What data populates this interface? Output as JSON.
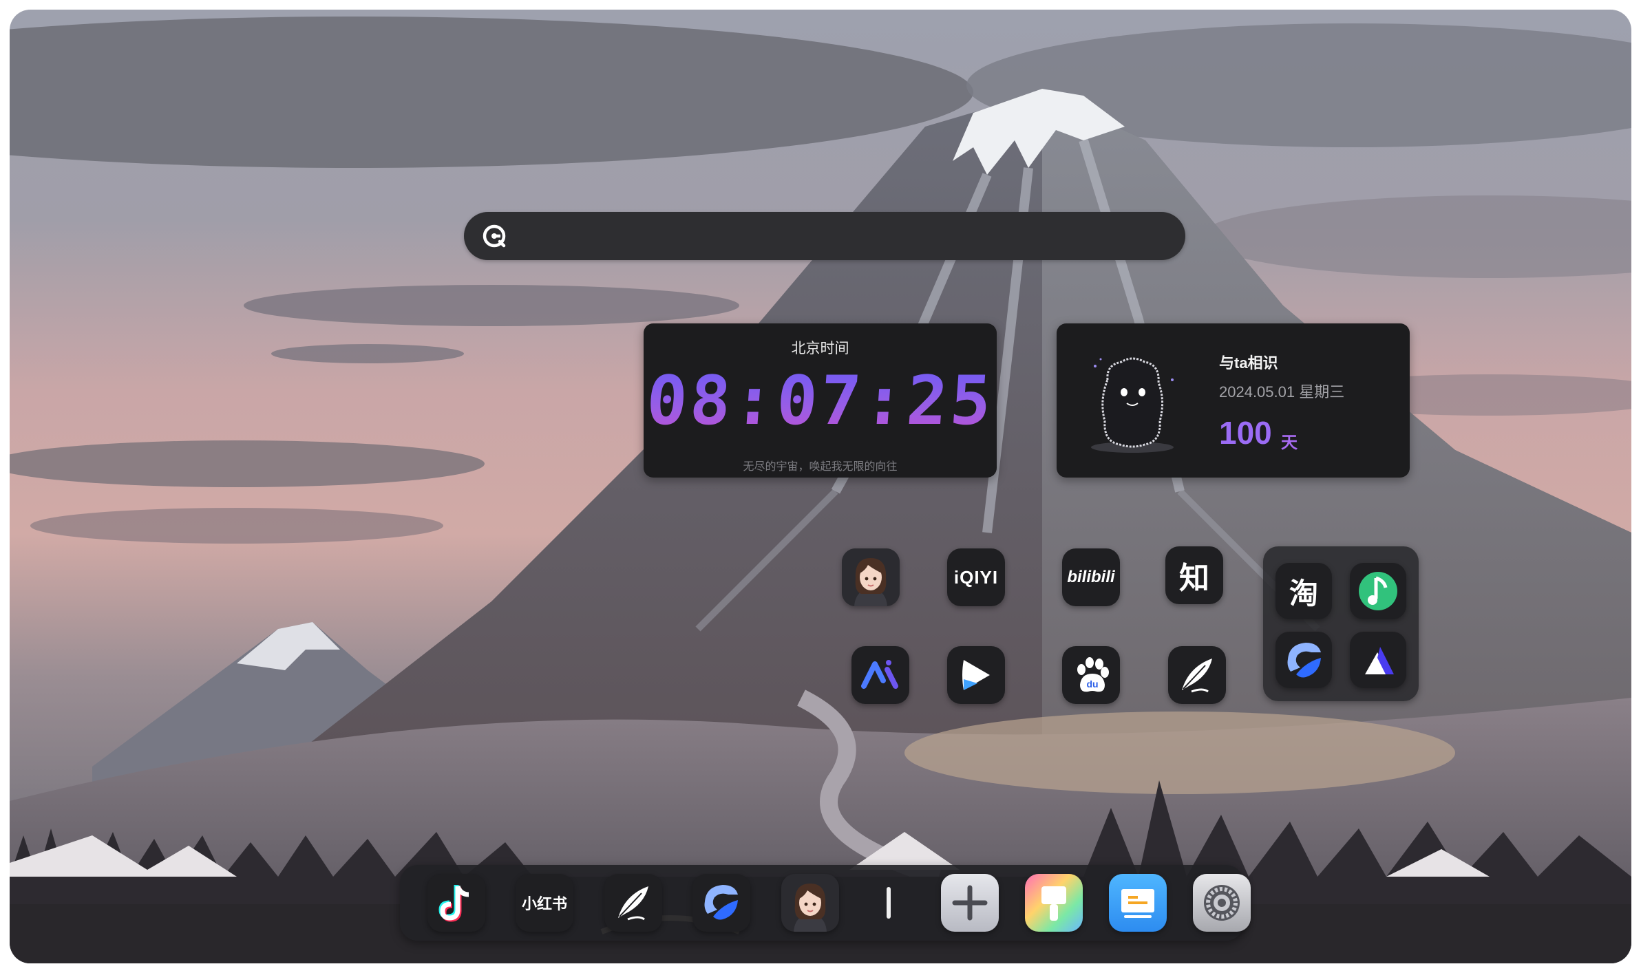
{
  "search": {
    "placeholder": "",
    "icon": "search-logo-icon"
  },
  "clock_widget": {
    "title": "北京时间",
    "time": "08:07:25",
    "subtitle": "无尽的宇宙，唤起我无限的向往"
  },
  "anniversary_widget": {
    "title": "与ta相识",
    "date": "2024.05.01  星期三",
    "count": "100",
    "unit": "天"
  },
  "apps": {
    "iqiyi": "iQIYI",
    "bilibili": "bilibili",
    "zhihu": "知",
    "taobao": "淘",
    "xiaohongshu": "小红书"
  },
  "folder_apps": [
    "taobao",
    "qq-music",
    "blue-bird",
    "triangle"
  ],
  "dock_items": [
    "tiktok",
    "xiaohongshu",
    "feather",
    "blue-bird",
    "avatar",
    "divider",
    "add",
    "brush",
    "slides",
    "settings"
  ],
  "colors": {
    "accent_purple": "#9b6cf5",
    "widget_bg": "#1c1c1e",
    "dock_bg": "#222226"
  }
}
